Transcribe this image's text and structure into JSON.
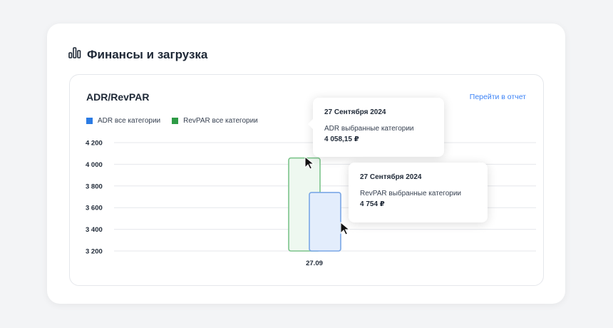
{
  "section": {
    "title": "Финансы и загрузка",
    "icon": "bar-chart-icon"
  },
  "card": {
    "title": "ADR/RevPAR",
    "report_link": "Перейти в отчет"
  },
  "legend": [
    {
      "label": "ADR все категории",
      "color": "#2b7be4"
    },
    {
      "label": "RevPAR все категории",
      "color": "#2e9b46"
    }
  ],
  "chart_data": {
    "type": "bar",
    "categories": [
      "27.09"
    ],
    "series": [
      {
        "name": "ADR все категории",
        "values": [
          4058.15
        ],
        "color": "#7cc48b",
        "fill": "#eef8f0"
      },
      {
        "name": "RevPAR все категории",
        "values": [
          3740
        ],
        "color": "#7aa7e6",
        "fill": "#e3edfc"
      }
    ],
    "y_ticks": [
      "4 200",
      "4 000",
      "3 800",
      "3 600",
      "3 400",
      "3 200"
    ],
    "ylim": [
      3200,
      4200
    ],
    "grid": true,
    "legend_position": "top-left"
  },
  "tooltips": [
    {
      "date": "27 Сентября 2024",
      "label": "ADR выбранные категории",
      "value": "4 058,15 ₽"
    },
    {
      "date": "27 Сентября 2024",
      "label": "RevPAR выбранные категории",
      "value": "4 754 ₽"
    }
  ]
}
